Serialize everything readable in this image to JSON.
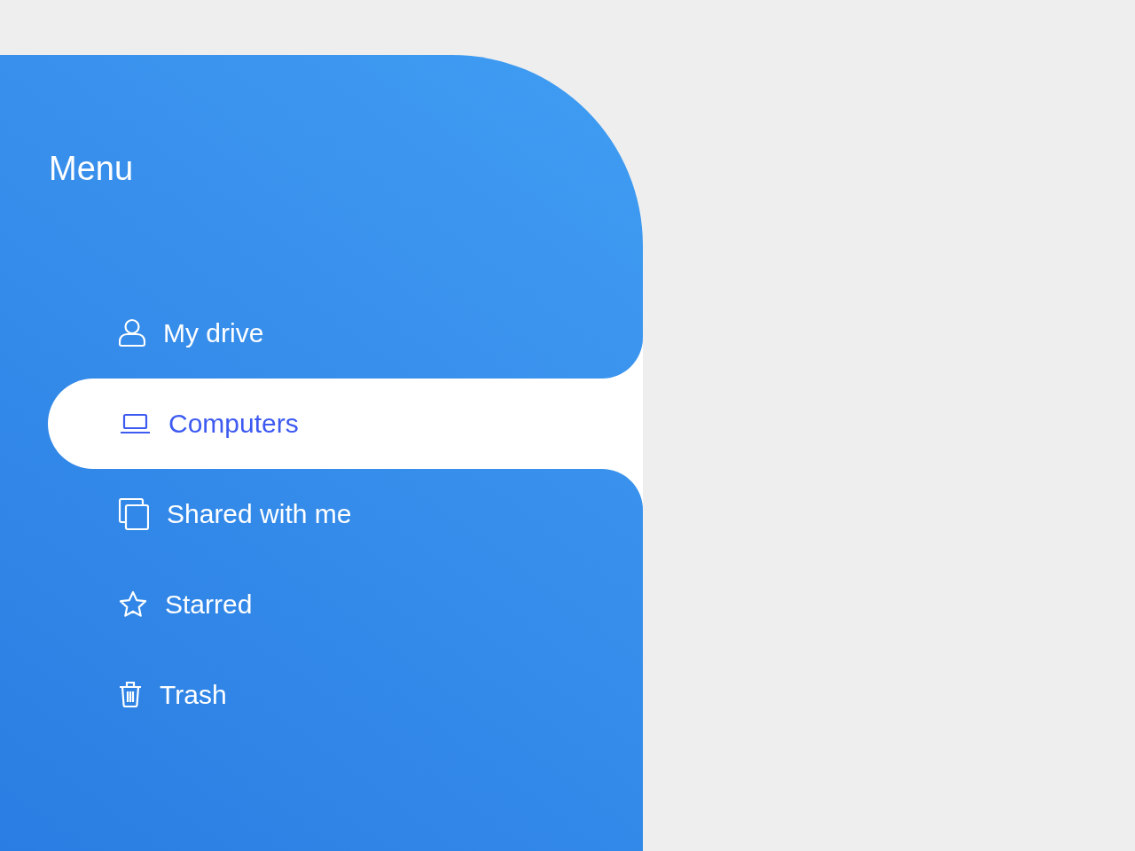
{
  "menu": {
    "title": "Menu",
    "items": [
      {
        "label": "My drive",
        "selected": false
      },
      {
        "label": "Computers",
        "selected": true
      },
      {
        "label": "Shared with me",
        "selected": false
      },
      {
        "label": "Starred",
        "selected": false
      },
      {
        "label": "Trash",
        "selected": false
      }
    ]
  }
}
